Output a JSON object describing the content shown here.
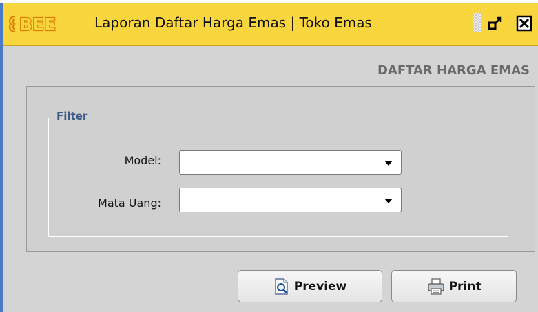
{
  "window": {
    "app_logo": "BEE",
    "title": "Laporan Daftar Harga Emas | Toko Emas",
    "controls": {
      "restore_icon": "restore-down-icon",
      "close_icon": "close-icon"
    },
    "colors": {
      "titlebar": "#f9d53e",
      "frame": "#4a79c8",
      "body": "#d4d4d4"
    }
  },
  "report": {
    "title": "DAFTAR HARGA EMAS"
  },
  "filter": {
    "legend": "Filter",
    "fields": [
      {
        "label": "Model:",
        "value": ""
      },
      {
        "label": "Mata Uang:",
        "value": ""
      }
    ]
  },
  "actions": {
    "preview": {
      "label": "Preview",
      "icon": "preview-magnifier-icon"
    },
    "print": {
      "label": "Print",
      "icon": "printer-icon"
    }
  }
}
